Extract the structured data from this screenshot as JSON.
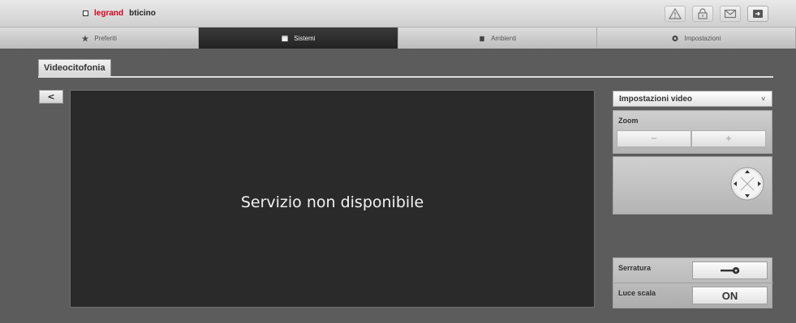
{
  "header": {
    "brand_legrand": "legrand",
    "brand_bticino": "bticino",
    "icons": [
      "warning-icon",
      "lock-icon",
      "mail-icon",
      "logout-icon"
    ]
  },
  "nav": {
    "tabs": [
      {
        "label": "Preferiti",
        "icon": "star-icon",
        "active": false
      },
      {
        "label": "Sistemi",
        "icon": "sistemi-icon",
        "active": true
      },
      {
        "label": "Ambienti",
        "icon": "ambienti-icon",
        "active": false
      },
      {
        "label": "Impostazioni",
        "icon": "impostazioni-icon",
        "active": false
      }
    ]
  },
  "section": {
    "title": "Videocitofonia"
  },
  "back": {
    "label": "<"
  },
  "video": {
    "message": "Servizio non disponibile"
  },
  "panel": {
    "select_label": "Impostazioni video",
    "zoom_label": "Zoom",
    "zoom_minus": "−",
    "zoom_plus": "+",
    "lock_label": "Serratura",
    "stair_label": "Luce scala",
    "stair_button": "ON"
  },
  "colors": {
    "accent": "#d6001c",
    "active_tab": "#2a2a2a",
    "background": "#5c5c5c"
  }
}
